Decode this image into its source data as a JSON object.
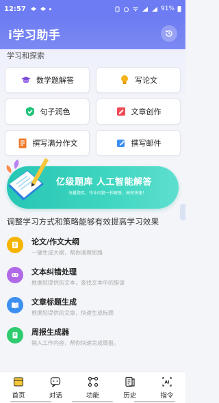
{
  "status_bar": {
    "time": "12:57",
    "battery": "91%"
  },
  "app": {
    "title": "i学习助手"
  },
  "section_title": "学习和探索",
  "tools": [
    {
      "label": "数学题解答",
      "icon": "graduation-cap-icon"
    },
    {
      "label": "写论文",
      "icon": "lightbulb-icon"
    },
    {
      "label": "句子润色",
      "icon": "check-shield-icon"
    },
    {
      "label": "文章创作",
      "icon": "article-edit-icon"
    },
    {
      "label": "撰写满分作文",
      "icon": "document-list-icon"
    },
    {
      "label": "撰写邮件",
      "icon": "pen-edit-icon"
    }
  ],
  "banner": {
    "title": "亿级题库  人工智能解答",
    "subtitle": "海量题库，作业问题一秒解答，高效快速！"
  },
  "headline": "调整学习方式和策略能够有效提高学习效果",
  "list": [
    {
      "title": "论文/作文大纲",
      "desc": "一键生成大纲，帮你清理思路",
      "icon": "outline-icon",
      "color": "#f4b400"
    },
    {
      "title": "文本纠错处理",
      "desc": "根据您提供的文本，查找文本中的错误",
      "icon": "proofread-icon",
      "color": "#b06ae6"
    },
    {
      "title": "文章标题生成",
      "desc": "根据您提供的文章，快速生成标题",
      "icon": "book-icon",
      "color": "#3d8ff0"
    },
    {
      "title": "周报生成器",
      "desc": "输入工作内容，帮你快速完成周报。",
      "icon": "report-icon",
      "color": "#2ecb6f"
    }
  ],
  "tabs": [
    {
      "label": "首页",
      "icon": "home-icon"
    },
    {
      "label": "对话",
      "icon": "chat-icon"
    },
    {
      "label": "功能",
      "icon": "function-icon"
    },
    {
      "label": "历史",
      "icon": "history-icon"
    },
    {
      "label": "指令",
      "icon": "ai-command-icon"
    }
  ],
  "colors": {
    "primary": "#6d7cf2",
    "banner": "#2fcdb9"
  }
}
